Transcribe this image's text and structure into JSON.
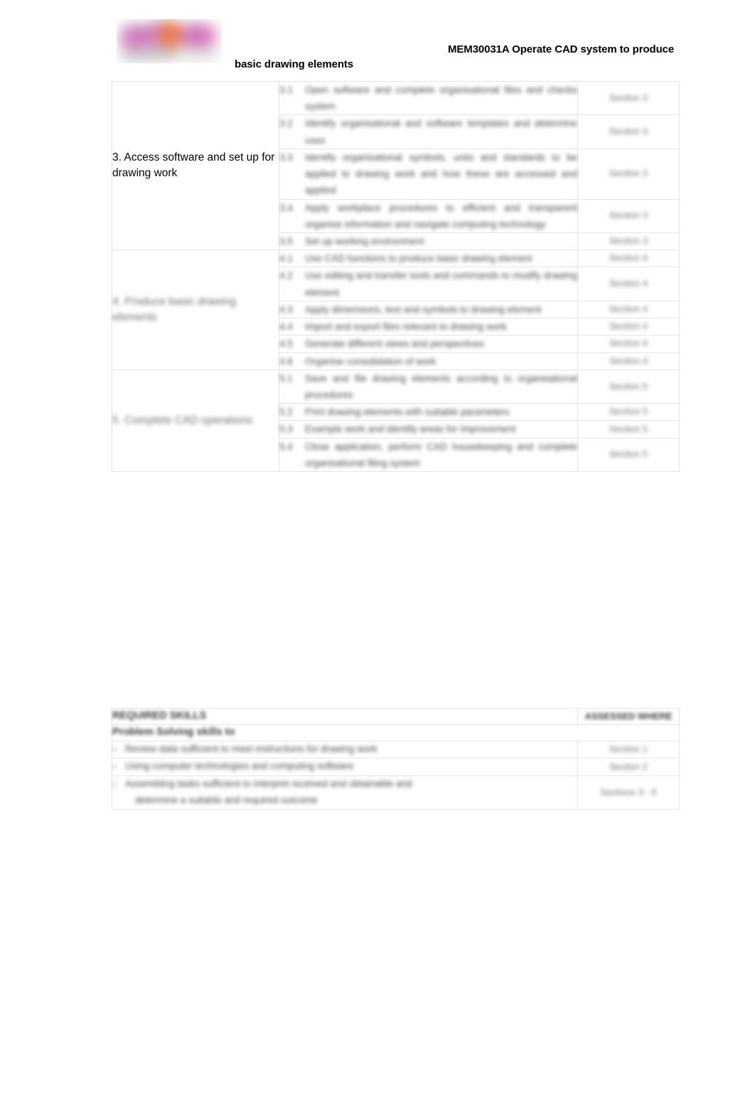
{
  "header": {
    "title_line_1": "MEM30031A Operate CAD system to produce",
    "title_line_2": "basic drawing elements",
    "logo_alt": "organisation-logo"
  },
  "table": {
    "groups": [
      {
        "label": "3. Access software and set up for drawing work",
        "label_redacted": false,
        "rows": [
          {
            "num": "3.1",
            "text": "Open software and complete organisational files and checks system",
            "section": "Section 3"
          },
          {
            "num": "3.2",
            "text": "Identify organisational and software templates and determine uses",
            "section": "Section 3"
          },
          {
            "num": "3.3",
            "text": "Identify organisational symbols, units and standards to be applied to drawing work and how these are accessed and applied",
            "section": "Section 3"
          },
          {
            "num": "3.4",
            "text": "Apply workplace procedures to efficient and transparent organise information and navigate computing technology",
            "section": "Section 3"
          },
          {
            "num": "3.5",
            "text": "Set up working environment",
            "section": "Section 3"
          }
        ]
      },
      {
        "label": "4. Produce basic drawing elements",
        "label_redacted": true,
        "rows": [
          {
            "num": "4.1",
            "text": "Use CAD functions to produce basic drawing element",
            "section": "Section 4"
          },
          {
            "num": "4.2",
            "text": "Use editing and transfer tools and commands to modify drawing element",
            "section": "Section 4"
          },
          {
            "num": "4.3",
            "text": "Apply dimensions, text and symbols to drawing element",
            "section": "Section 4"
          },
          {
            "num": "4.4",
            "text": "Import and export files relevant to drawing work",
            "section": "Section 4"
          },
          {
            "num": "4.5",
            "text": "Generate different views and perspectives",
            "section": "Section 4"
          },
          {
            "num": "4.6",
            "text": "Organise consolidation of work",
            "section": "Section 4"
          }
        ]
      },
      {
        "label": "5. Complete CAD operations",
        "label_redacted": true,
        "rows": [
          {
            "num": "5.1",
            "text": "Save and file drawing elements according to organisational procedures",
            "section": "Section 5"
          },
          {
            "num": "5.2",
            "text": "Print drawing elements with suitable parameters",
            "section": "Section 5"
          },
          {
            "num": "5.3",
            "text": "Example work and identify areas for improvement",
            "section": "Section 5"
          },
          {
            "num": "5.4",
            "text": "Close application, perform CAD housekeeping and complete organisational filing system",
            "section": "Section 5"
          }
        ]
      }
    ]
  },
  "skills": {
    "heading": "REQUIRED SKILLS",
    "heading_section": "ASSESSED WHERE",
    "subheading": "Problem Solving skills to",
    "bullets": [
      {
        "text_line_1": "Review data sufficient to meet instructions for drawing work",
        "text_line_2": "",
        "section_line_1": "Section 1",
        "section_line_2": ""
      },
      {
        "text_line_1": "Using computer technologies and computing software",
        "text_line_2": "",
        "section_line_1": "Section 2",
        "section_line_2": ""
      },
      {
        "text_line_1": "Assembling tasks sufficient to interpret received and obtainable and",
        "text_line_2": "determine a suitable and required outcome",
        "section_line_1": "Sections 3 - 5",
        "section_line_2": ""
      }
    ]
  }
}
